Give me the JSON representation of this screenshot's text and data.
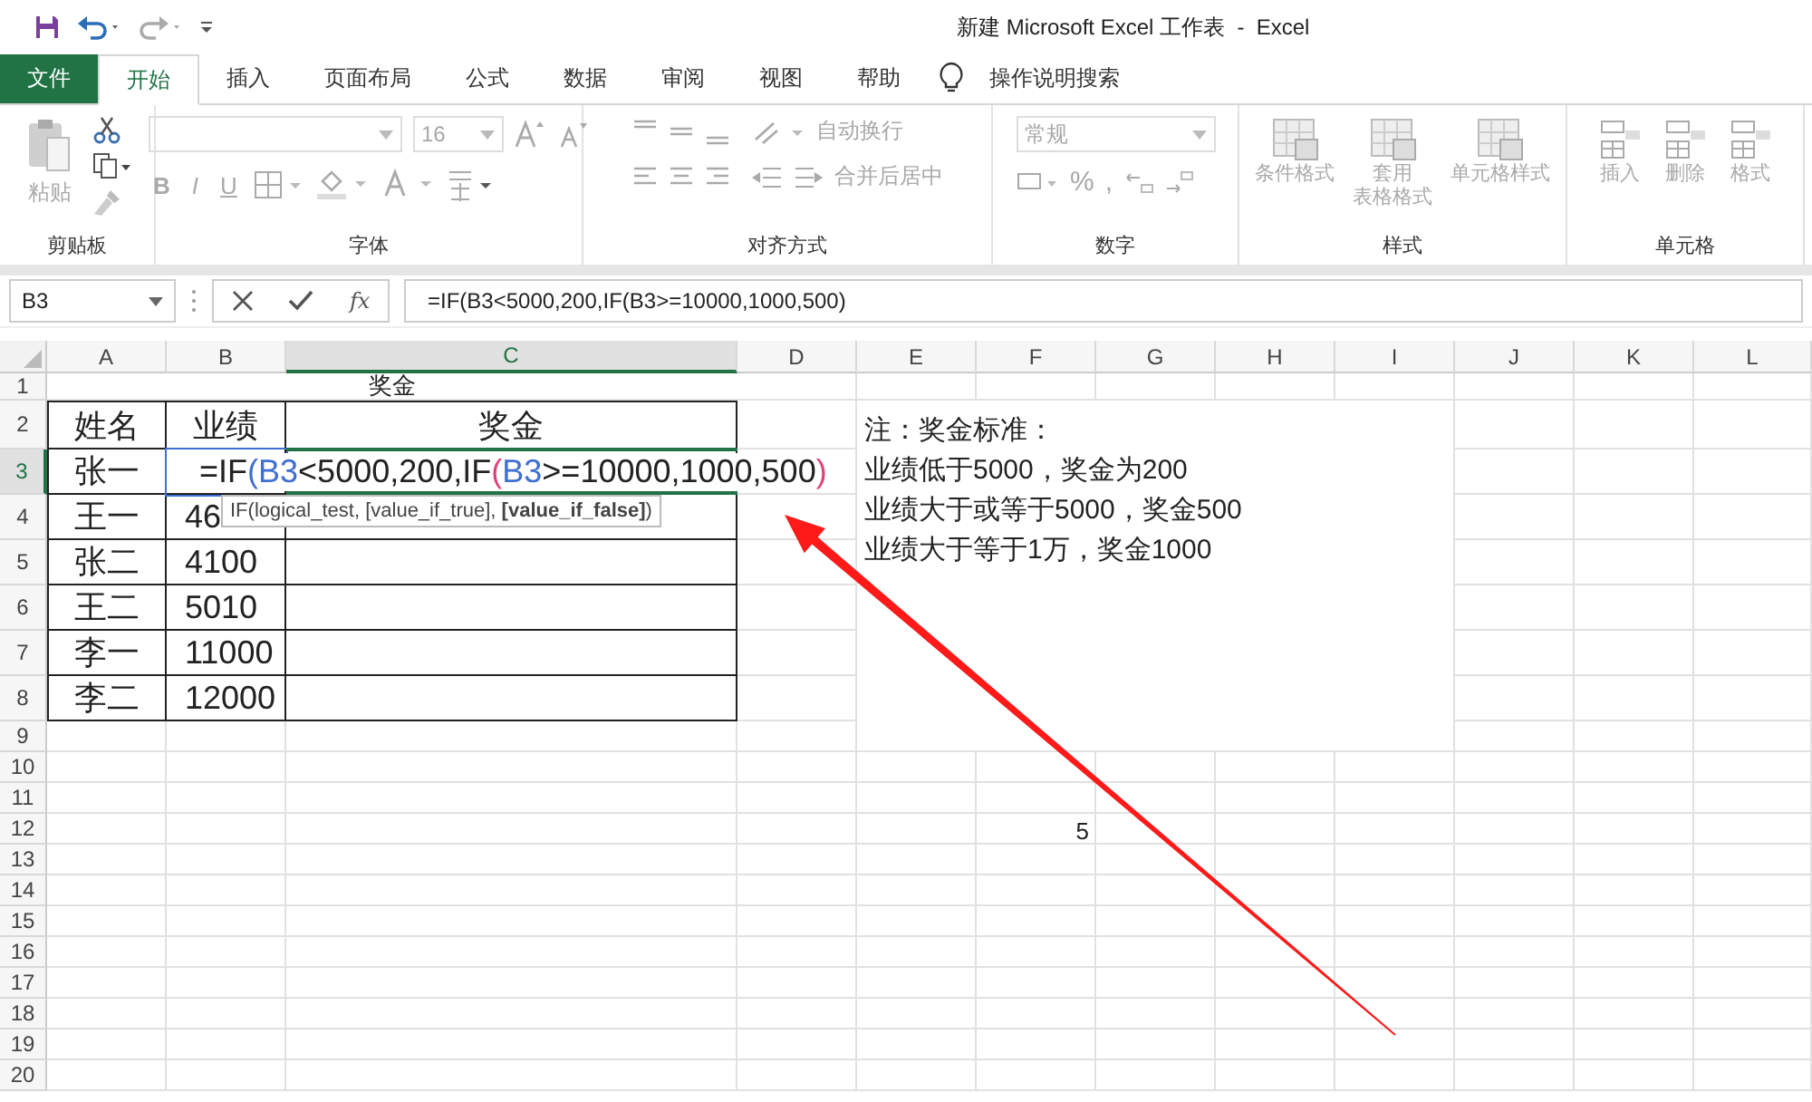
{
  "title_bar": {
    "title": "新建 Microsoft Excel 工作表  -  Excel"
  },
  "ribbon_tabs": [
    {
      "label": "文件",
      "kind": "file",
      "selected": false
    },
    {
      "label": "开始",
      "kind": "tab",
      "selected": true
    },
    {
      "label": "插入",
      "kind": "tab",
      "selected": false
    },
    {
      "label": "页面布局",
      "kind": "tab",
      "selected": false
    },
    {
      "label": "公式",
      "kind": "tab",
      "selected": false
    },
    {
      "label": "数据",
      "kind": "tab",
      "selected": false
    },
    {
      "label": "审阅",
      "kind": "tab",
      "selected": false
    },
    {
      "label": "视图",
      "kind": "tab",
      "selected": false
    },
    {
      "label": "帮助",
      "kind": "tab",
      "selected": false
    }
  ],
  "tell_me": {
    "label": "操作说明搜索"
  },
  "ribbon": {
    "clipboard": {
      "label": "剪贴板",
      "paste": "粘贴"
    },
    "font": {
      "label": "字体",
      "font_size": "16",
      "format_buttons": [
        "B",
        "I",
        "U"
      ]
    },
    "alignment": {
      "label": "对齐方式",
      "wrap_text": "自动换行",
      "merge_center": "合并后居中"
    },
    "number": {
      "label": "数字",
      "format": "常规",
      "percent": "%",
      "comma": ","
    },
    "styles": {
      "label": "样式",
      "buttons": [
        {
          "lines": [
            "条件格式"
          ]
        },
        {
          "lines": [
            "套用",
            "表格格式"
          ]
        },
        {
          "lines": [
            "单元格样式"
          ]
        }
      ]
    },
    "cells": {
      "label": "单元格",
      "buttons": [
        "插入",
        "删除",
        "格式"
      ]
    }
  },
  "formula_bar": {
    "name_box": "B3",
    "function_label": "fx",
    "formula": "=IF(B3<5000,200,IF(B3>=10000,1000,500)"
  },
  "sheet": {
    "columns": [
      {
        "label": "A",
        "selected": false
      },
      {
        "label": "B",
        "selected": false
      },
      {
        "label": "C",
        "selected": true
      },
      {
        "label": "D",
        "selected": false
      },
      {
        "label": "E",
        "selected": false
      },
      {
        "label": "F",
        "selected": false
      },
      {
        "label": "G",
        "selected": false
      },
      {
        "label": "H",
        "selected": false
      },
      {
        "label": "I",
        "selected": false
      },
      {
        "label": "J",
        "selected": false
      },
      {
        "label": "K",
        "selected": false
      },
      {
        "label": "L",
        "selected": false
      }
    ],
    "rows": [
      {
        "label": "1",
        "selected": false
      },
      {
        "label": "2",
        "selected": false
      },
      {
        "label": "3",
        "selected": true
      },
      {
        "label": "4",
        "selected": false
      },
      {
        "label": "5",
        "selected": false
      },
      {
        "label": "6",
        "selected": false
      },
      {
        "label": "7",
        "selected": false
      },
      {
        "label": "8",
        "selected": false
      },
      {
        "label": "9",
        "selected": false
      },
      {
        "label": "10",
        "selected": false
      },
      {
        "label": "11",
        "selected": false
      },
      {
        "label": "12",
        "selected": false
      },
      {
        "label": "13",
        "selected": false
      },
      {
        "label": "14",
        "selected": false
      },
      {
        "label": "15",
        "selected": false
      },
      {
        "label": "16",
        "selected": false
      },
      {
        "label": "17",
        "selected": false
      },
      {
        "label": "18",
        "selected": false
      },
      {
        "label": "19",
        "selected": false
      },
      {
        "label": "20",
        "selected": false
      }
    ],
    "merged_title": "奖金",
    "table_header": [
      "姓名",
      "业绩",
      "奖金"
    ],
    "table_rows": [
      {
        "name": "张一"
      },
      {
        "name": "王一",
        "value": "46"
      },
      {
        "name": "张二",
        "value": "4100"
      },
      {
        "name": "王二",
        "value": "5010"
      },
      {
        "name": "李一",
        "value": "11000"
      },
      {
        "name": "李二",
        "value": "12000"
      }
    ],
    "editing_cell": {
      "tokens": [
        {
          "text": "=IF"
        },
        {
          "text": "(",
          "color": "#3f6fd1"
        },
        {
          "text": "B3",
          "color": "#3f6fd1"
        },
        {
          "text": "<5000,200,IF"
        },
        {
          "text": "(",
          "color": "#e0407a"
        },
        {
          "text": "B3",
          "color": "#3f6fd1"
        },
        {
          "text": ">=10000,1000,500"
        },
        {
          "text": ")",
          "color": "#e0407a"
        }
      ]
    },
    "tooltip": "IF(logical_test, [value_if_true], **[value_if_false]**)",
    "note_lines": [
      "注：奖金标准：",
      "业绩低于5000，奖金为200",
      "业绩大于或等于5000，奖金500",
      "业绩大于等于1万，奖金1000"
    ],
    "stray_value": "5"
  }
}
